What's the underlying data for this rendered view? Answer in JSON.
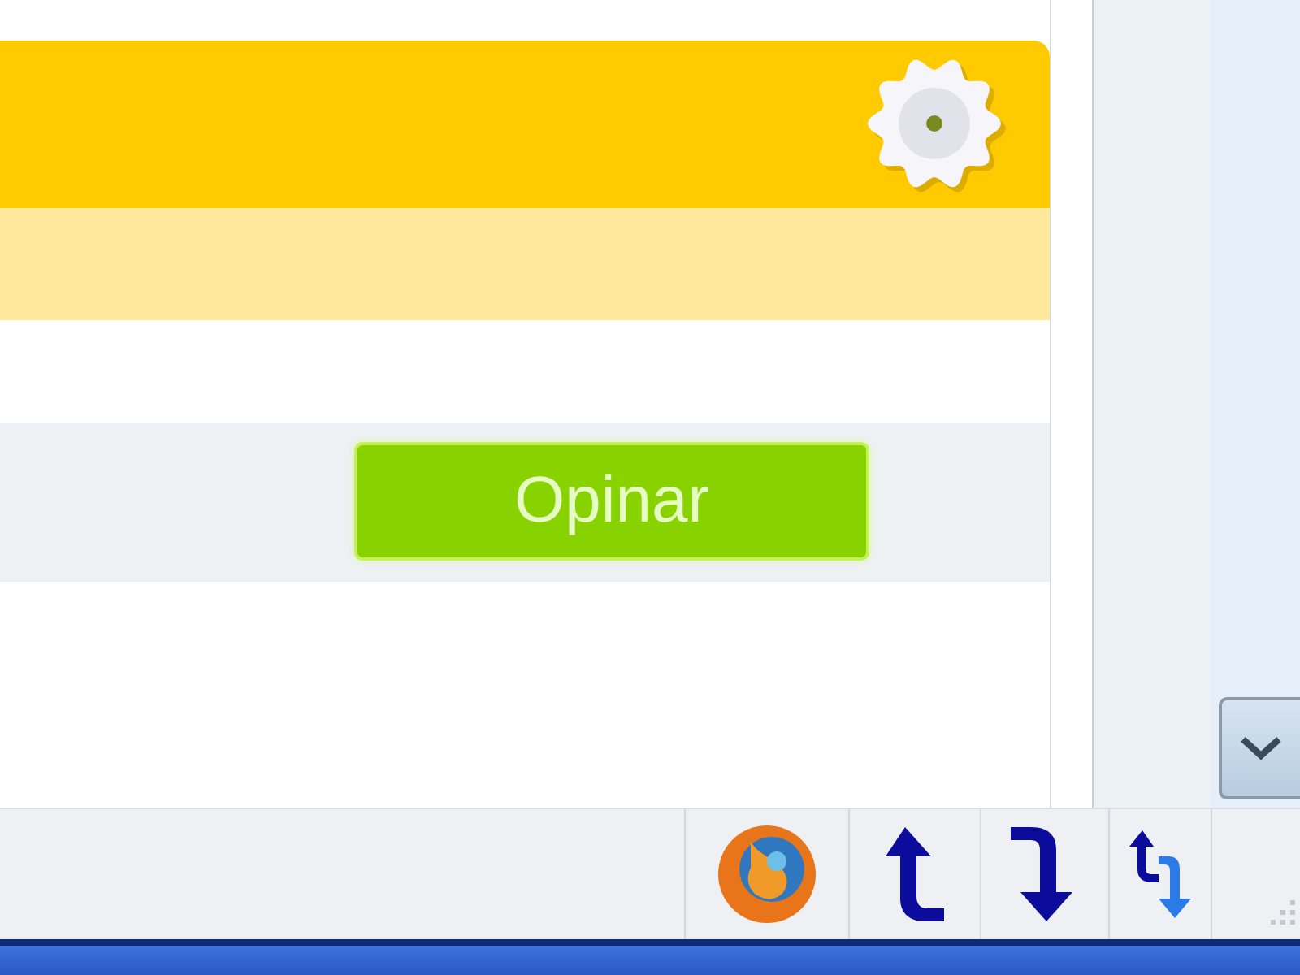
{
  "panel": {
    "action_button": {
      "label": "Opinar"
    }
  }
}
